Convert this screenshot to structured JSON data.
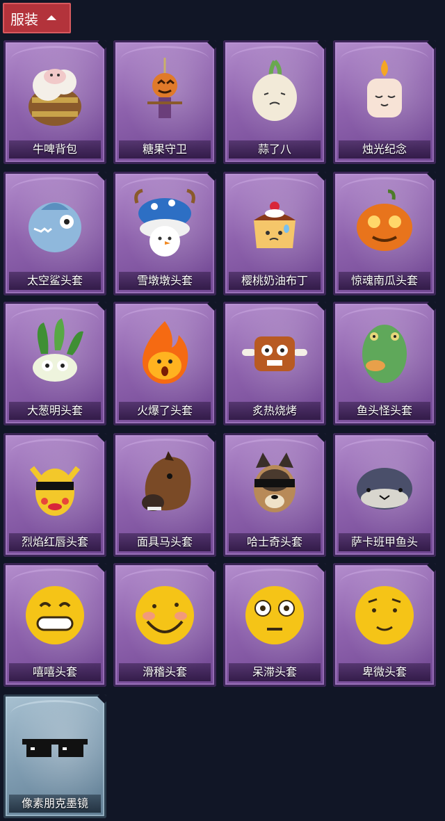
{
  "section": {
    "label": "服装"
  },
  "items": [
    {
      "label": "牛啤背包",
      "icon": "cow-beer-backpack-icon",
      "theme": "purple"
    },
    {
      "label": "糖果守卫",
      "icon": "pumpkin-scarecrow-icon",
      "theme": "purple"
    },
    {
      "label": "蒜了八",
      "icon": "garlic-icon",
      "theme": "purple"
    },
    {
      "label": "烛光纪念",
      "icon": "candle-icon",
      "theme": "purple"
    },
    {
      "label": "太空鲨头套",
      "icon": "shark-head-icon",
      "theme": "purple"
    },
    {
      "label": "雪墩墩头套",
      "icon": "snowman-head-icon",
      "theme": "purple"
    },
    {
      "label": "樱桃奶油布丁",
      "icon": "pudding-icon",
      "theme": "purple"
    },
    {
      "label": "惊魂南瓜头套",
      "icon": "jack-o-lantern-icon",
      "theme": "purple"
    },
    {
      "label": "大葱明头套",
      "icon": "leek-head-icon",
      "theme": "purple"
    },
    {
      "label": "火爆了头套",
      "icon": "fire-head-icon",
      "theme": "purple"
    },
    {
      "label": "炙热烧烤",
      "icon": "barbecue-meat-icon",
      "theme": "purple"
    },
    {
      "label": "鱼头怪头套",
      "icon": "fish-head-icon",
      "theme": "purple"
    },
    {
      "label": "烈焰红唇头套",
      "icon": "yellow-mask-sunglasses-icon",
      "theme": "purple"
    },
    {
      "label": "面具马头套",
      "icon": "horse-head-icon",
      "theme": "purple"
    },
    {
      "label": "哈士奇头套",
      "icon": "husky-head-icon",
      "theme": "purple"
    },
    {
      "label": "萨卡班甲鱼头",
      "icon": "fish-blob-icon",
      "theme": "purple"
    },
    {
      "label": "嘻嘻头套",
      "icon": "grin-emoji-icon",
      "theme": "purple"
    },
    {
      "label": "滑稽头套",
      "icon": "funny-emoji-icon",
      "theme": "purple"
    },
    {
      "label": "呆滞头套",
      "icon": "dazed-emoji-icon",
      "theme": "purple"
    },
    {
      "label": "卑微头套",
      "icon": "humble-emoji-icon",
      "theme": "purple"
    },
    {
      "label": "像素朋克墨镜",
      "icon": "pixel-sunglasses-icon",
      "theme": "blue"
    }
  ]
}
